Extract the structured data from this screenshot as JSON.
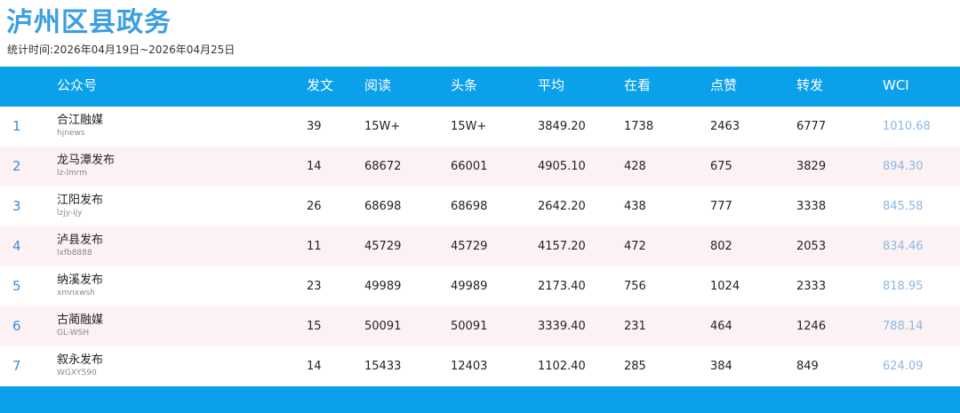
{
  "title": "泸州区县政务",
  "subtitle": "统计时间:2026年04月19日~2026年04月25日",
  "columns": {
    "account": "公众号",
    "posts": "发文",
    "reads": "阅读",
    "headline": "头条",
    "average": "平均",
    "watching": "在看",
    "likes": "点赞",
    "shares": "转发",
    "wci": "WCI"
  },
  "rows": [
    {
      "rank": "1",
      "name": "合江融媒",
      "id": "hjnews",
      "posts": "39",
      "reads": "15W+",
      "headline": "15W+",
      "average": "3849.20",
      "watching": "1738",
      "likes": "2463",
      "shares": "6777",
      "wci": "1010.68"
    },
    {
      "rank": "2",
      "name": "龙马潭发布",
      "id": "lz-lmrm",
      "posts": "14",
      "reads": "68672",
      "headline": "66001",
      "average": "4905.10",
      "watching": "428",
      "likes": "675",
      "shares": "3829",
      "wci": "894.30"
    },
    {
      "rank": "3",
      "name": "江阳发布",
      "id": "lzjy-ijy",
      "posts": "26",
      "reads": "68698",
      "headline": "68698",
      "average": "2642.20",
      "watching": "438",
      "likes": "777",
      "shares": "3338",
      "wci": "845.58"
    },
    {
      "rank": "4",
      "name": "泸县发布",
      "id": "lxfb8888",
      "posts": "11",
      "reads": "45729",
      "headline": "45729",
      "average": "4157.20",
      "watching": "472",
      "likes": "802",
      "shares": "2053",
      "wci": "834.46"
    },
    {
      "rank": "5",
      "name": "纳溪发布",
      "id": "xmnxwsh",
      "posts": "23",
      "reads": "49989",
      "headline": "49989",
      "average": "2173.40",
      "watching": "756",
      "likes": "1024",
      "shares": "2333",
      "wci": "818.95"
    },
    {
      "rank": "6",
      "name": "古蔺融媒",
      "id": "GL-WSH",
      "posts": "15",
      "reads": "50091",
      "headline": "50091",
      "average": "3339.40",
      "watching": "231",
      "likes": "464",
      "shares": "1246",
      "wci": "788.14"
    },
    {
      "rank": "7",
      "name": "叙永发布",
      "id": "WGXY590",
      "posts": "14",
      "reads": "15433",
      "headline": "12403",
      "average": "1102.40",
      "watching": "285",
      "likes": "384",
      "shares": "849",
      "wci": "624.09"
    }
  ]
}
